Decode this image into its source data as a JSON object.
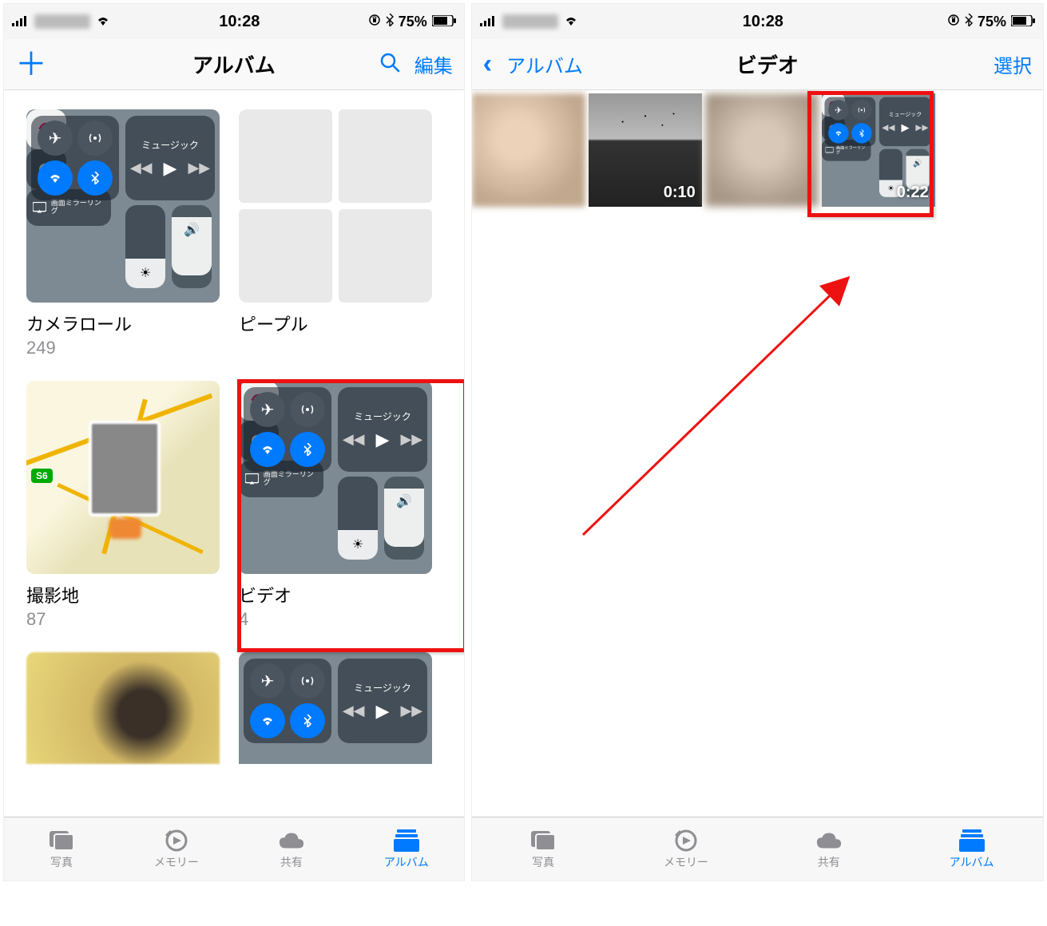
{
  "status": {
    "time": "10:28",
    "battery_percent": "75%"
  },
  "left": {
    "nav": {
      "title": "アルバム",
      "edit": "編集"
    },
    "albums": [
      {
        "title": "カメラロール",
        "count": "249"
      },
      {
        "title": "ピープル",
        "count": ""
      },
      {
        "title": "撮影地",
        "count": "87"
      },
      {
        "title": "ビデオ",
        "count": "4"
      }
    ],
    "map_badge": "S6",
    "cc_music_label": "ミュージック",
    "cc_mirror_label": "画面ミラーリング"
  },
  "right": {
    "nav": {
      "back": "アルバム",
      "title": "ビデオ",
      "select": "選択"
    },
    "videos": [
      {
        "duration": ""
      },
      {
        "duration": "0:10"
      },
      {
        "duration": ""
      },
      {
        "duration": "0:22"
      }
    ]
  },
  "tabs": {
    "photos": "写真",
    "memories": "メモリー",
    "shared": "共有",
    "albums": "アルバム"
  }
}
